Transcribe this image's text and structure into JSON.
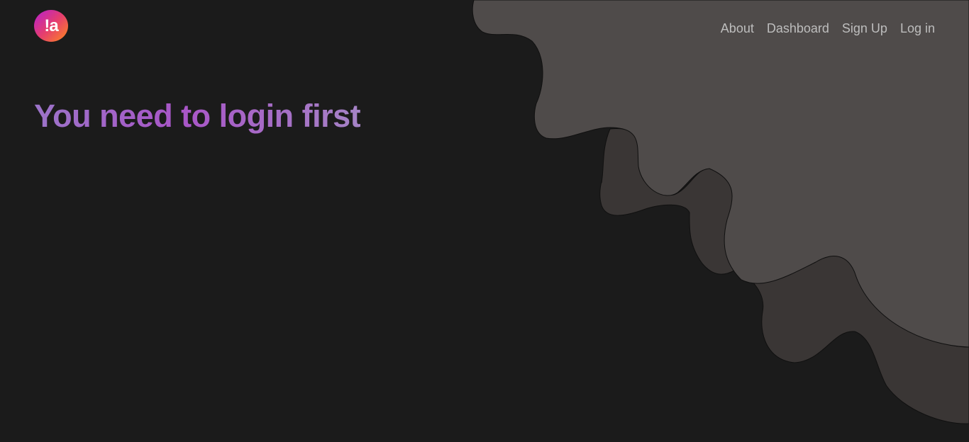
{
  "header": {
    "logo_text": "!a",
    "nav": [
      {
        "label": "About"
      },
      {
        "label": "Dashboard"
      },
      {
        "label": "Sign Up"
      },
      {
        "label": "Log in"
      }
    ]
  },
  "main": {
    "headline": "You need to login first"
  },
  "colors": {
    "background": "#1b1b1b",
    "blob_light": "#4f4b4a",
    "blob_dark": "#3a3635",
    "nav_text": "#bdbdbd",
    "headline_gradient": [
      "#9c74c9",
      "#a855c7",
      "#a583c6"
    ],
    "logo_gradient": [
      "#b51fd1",
      "#e53d6f",
      "#ff8a1c"
    ]
  }
}
